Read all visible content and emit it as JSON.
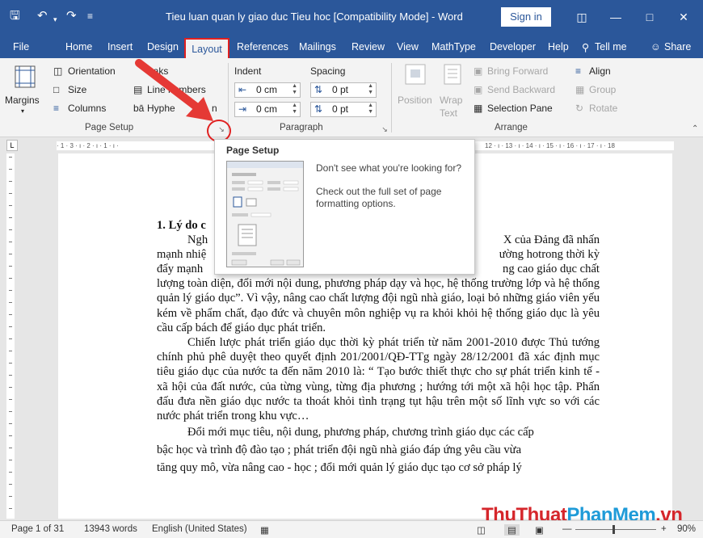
{
  "titlebar": {
    "title": "Tieu luan quan ly giao duc Tieu hoc [Compatibility Mode]  -  Word",
    "signin": "Sign in",
    "save_icon": "save-icon",
    "undo_icon": "undo-icon",
    "redo_icon": "redo-icon"
  },
  "tabs": [
    "File",
    "Home",
    "Insert",
    "Design",
    "Layout",
    "References",
    "Mailings",
    "Review",
    "View",
    "MathType",
    "Developer",
    "Help",
    "Tell me",
    "Share"
  ],
  "ribbon": {
    "page_setup": {
      "margins": "Margins",
      "orientation": "Orientation",
      "size": "Size",
      "columns": "Columns",
      "breaks": "eaks",
      "line_numbers": "Line numbers",
      "hyphenation": "Hyphe",
      "hyphenation_tail": "n",
      "label": "Page Setup"
    },
    "paragraph": {
      "indent": "Indent",
      "spacing": "Spacing",
      "indent_left": "0 cm",
      "indent_right": "0 cm",
      "spacing_before": "0 pt",
      "spacing_after": "0 pt",
      "label": "Paragraph"
    },
    "arrange": {
      "position": "Position",
      "wrap_text_1": "Wrap",
      "wrap_text_2": "Text",
      "bring_forward": "Bring Forward",
      "send_backward": "Send Backward",
      "selection_pane": "Selection Pane",
      "align": "Align",
      "group": "Group",
      "rotate": "Rotate",
      "label": "Arrange"
    }
  },
  "ruler": {
    "left": "· 1 · 3 · ı · 2 · ı · 1 · ı ·",
    "right": "12 · ı · 13 · ı · 14 · ı · 15 · ı · 16 · ı · 17 · ı · 18"
  },
  "tooltip": {
    "title": "Page Setup",
    "line1": "Don't see what you're looking for?",
    "line2": "Check out the full set of page formatting options."
  },
  "document": {
    "heading": "1. Lý do c",
    "p1_l1_left": "Ngh",
    "p1_l1_right": "X của Đảng đã nhấn",
    "p1_l2_left": "mạnh nhiệ",
    "p1_l2_right": "ường hotrong thời kỳ",
    "p1_l3_left": "đẩy mạnh",
    "p1_l3_right": "ng cao giáo dục chất",
    "p1_rest": "lượng toàn diện, đổi mới nội dung, phương pháp dạy và học, hệ thống trường lớp và hệ thống quản lý giáo dục”. Vì vậy, nâng cao chất lượng đội ngũ nhà giáo, loại bỏ những giáo viên yếu kém về phẩm chất, đạo đức và chuyên môn nghiệp vụ ra khỏi khỏi hệ thống giáo dục là yêu cầu cấp bách để giáo dục phát triển.",
    "p2": "Chiến lược phát triển giáo dục thời kỳ phát triển từ năm 2001-2010 được Thủ tướng chính phủ phê duyệt theo quyết định 201/2001/QĐ-TTg ngày 28/12/2001 đã xác định mục tiêu giáo dục của nước ta đến năm 2010 là: “ Tạo bước thiết thực cho sự phát triển kinh tế - xã hội của đất nước, của từng vùng, từng địa phương ; hướng tới một xã hội học tập. Phấn đấu đưa nền giáo dục nước ta thoát khỏi tình trạng tụt hậu trên một số lĩnh vực so với các nước phát triển trong khu vực…",
    "p3_l1": "Đổi mới mục tiêu, nội dung, phương pháp, chương trình giáo dục các cấp",
    "p3_l2": "bậc học và trình độ đào tạo ; phát triển đội ngũ nhà giáo đáp ứng yêu cầu vừa",
    "p3_l3": "tăng quy mô, vừa nâng cao - học ; đổi mới quản lý giáo dục tạo cơ sở pháp lý"
  },
  "watermark": {
    "part1": "ThuThuat",
    "part2": "PhanMem",
    "part3": ".vn"
  },
  "status": {
    "page": "Page 1 of 31",
    "words": "13943 words",
    "language": "English (United States)",
    "zoom": "90%",
    "zoom_level": 0.9
  },
  "colors": {
    "accent": "#2b579a",
    "highlight": "#e02020"
  }
}
